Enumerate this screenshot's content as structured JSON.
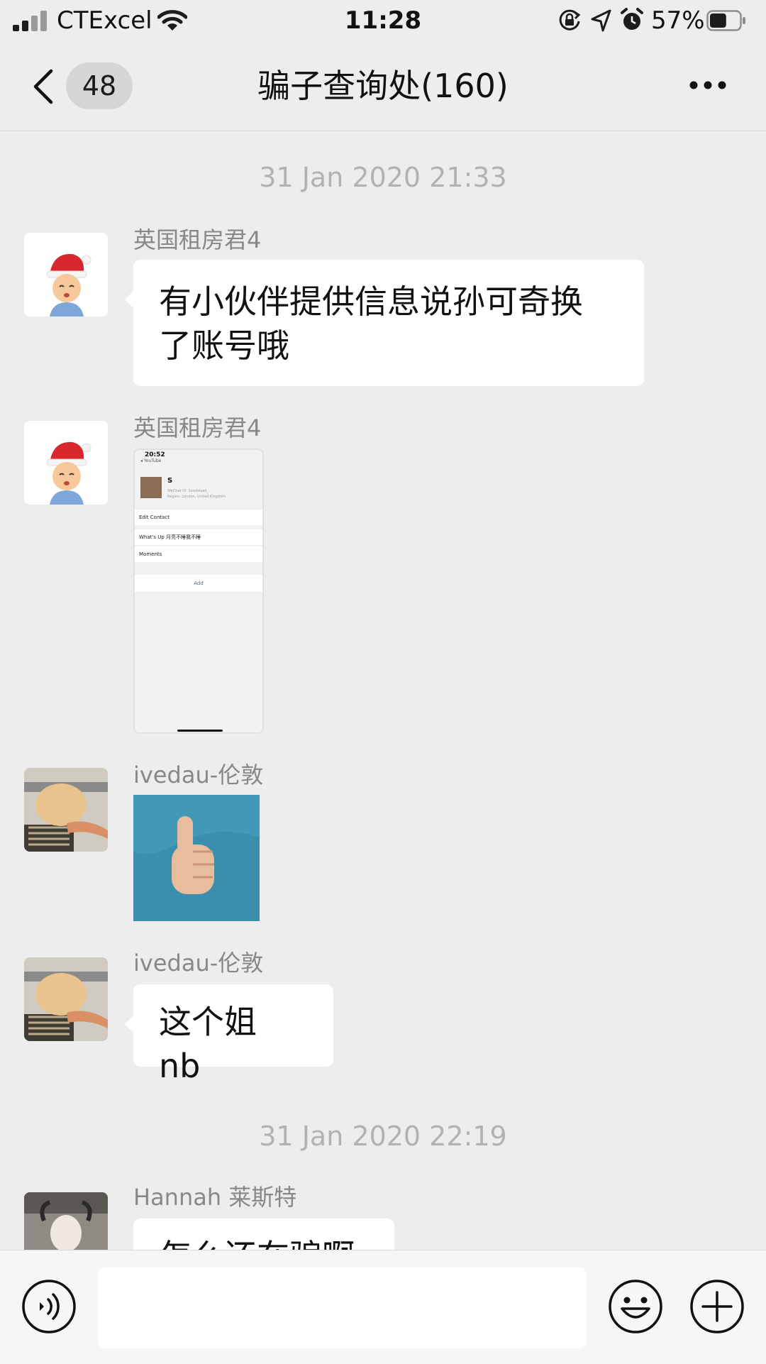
{
  "status_bar": {
    "carrier": "CTExcel",
    "time": "11:28",
    "battery_percent": "57%",
    "battery_level": 0.57,
    "icons": [
      "signal-icon",
      "wifi-icon",
      "orientation-lock-icon",
      "location-arrow-icon",
      "alarm-icon",
      "battery-icon"
    ]
  },
  "nav": {
    "back_icon": "chevron-left-icon",
    "unread_count": "48",
    "title": "骗子查询处(160)",
    "more_icon": "more-dots-icon"
  },
  "messages": [
    {
      "type": "timestamp",
      "text": "31 Jan 2020 21:33"
    },
    {
      "type": "text",
      "sender": "英国租房君4",
      "avatar": "santa-hat-cartoon-avatar",
      "text_lines": [
        "有小伙伴提供信息说孙可奇换",
        "了账号哦"
      ]
    },
    {
      "type": "image",
      "sender": "英国租房君4",
      "avatar": "santa-hat-cartoon-avatar",
      "image": {
        "kind": "wechat-profile-screenshot",
        "time": "20:52",
        "source": "◂ YouTube",
        "name": "S",
        "meta_wechat": "WeChat ID: Sssskkaaii_",
        "meta_region": "Region: London, United Kingdom",
        "rows": [
          "Edit Contact",
          "What's Up  月亮不睡我不睡",
          "Moments"
        ],
        "add_label": "Add"
      }
    },
    {
      "type": "image",
      "sender": "ivedau-伦敦",
      "avatar": "plush-toy-photo-avatar",
      "image": {
        "kind": "thumbs-up-sticker",
        "icon": "thumbs-up-icon"
      }
    },
    {
      "type": "text",
      "sender": "ivedau-伦敦",
      "avatar": "plush-toy-photo-avatar",
      "text_lines": [
        "这个姐 nb"
      ]
    },
    {
      "type": "timestamp",
      "text": "31 Jan 2020 22:19"
    },
    {
      "type": "text",
      "sender": "Hannah 莱斯特",
      "avatar": "portrait-photo-avatar",
      "text_lines": [
        "怎么还在骗啊"
      ]
    }
  ],
  "input_bar": {
    "voice_icon": "voice-icon",
    "input_value": "",
    "emoji_icon": "emoji-icon",
    "plus_icon": "plus-icon"
  }
}
